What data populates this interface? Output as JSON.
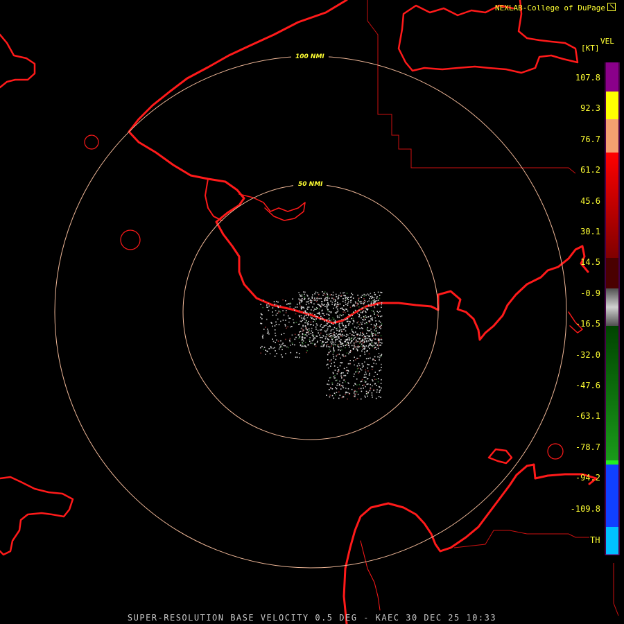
{
  "credit": "NEXLAB-College of DuPage",
  "product": "VEL",
  "unit": "[KT]",
  "footer": "SUPER-RESOLUTION BASE VELOCITY 0.5 DEG - KAEC 30 DEC 25 10:33",
  "range_rings": [
    {
      "label": "50 NMI"
    },
    {
      "label": "100 NMI"
    }
  ],
  "scale": {
    "ticks": [
      "107.8",
      "92.3",
      "76.7",
      "61.2",
      "45.6",
      "30.1",
      "14.5",
      "-0.9",
      "-16.5",
      "-32.0",
      "-47.6",
      "-63.1",
      "-78.7",
      "-94.2",
      "-109.8"
    ],
    "th_label": "TH",
    "colors": {
      "purple": "#8a008a",
      "yellow": "#ffff00",
      "peach": "#f4a070",
      "red": "#ff0000",
      "dark_red": "#4a0000",
      "gray": "#d0d0d0",
      "dark_green": "#004400",
      "green": "#22ee22",
      "blue": "#1040ff",
      "cyan": "#00c0ff"
    }
  },
  "map_colors": {
    "coast": "#ff1a1a",
    "rings": "#f0b898",
    "boundary": "#cc1111"
  }
}
